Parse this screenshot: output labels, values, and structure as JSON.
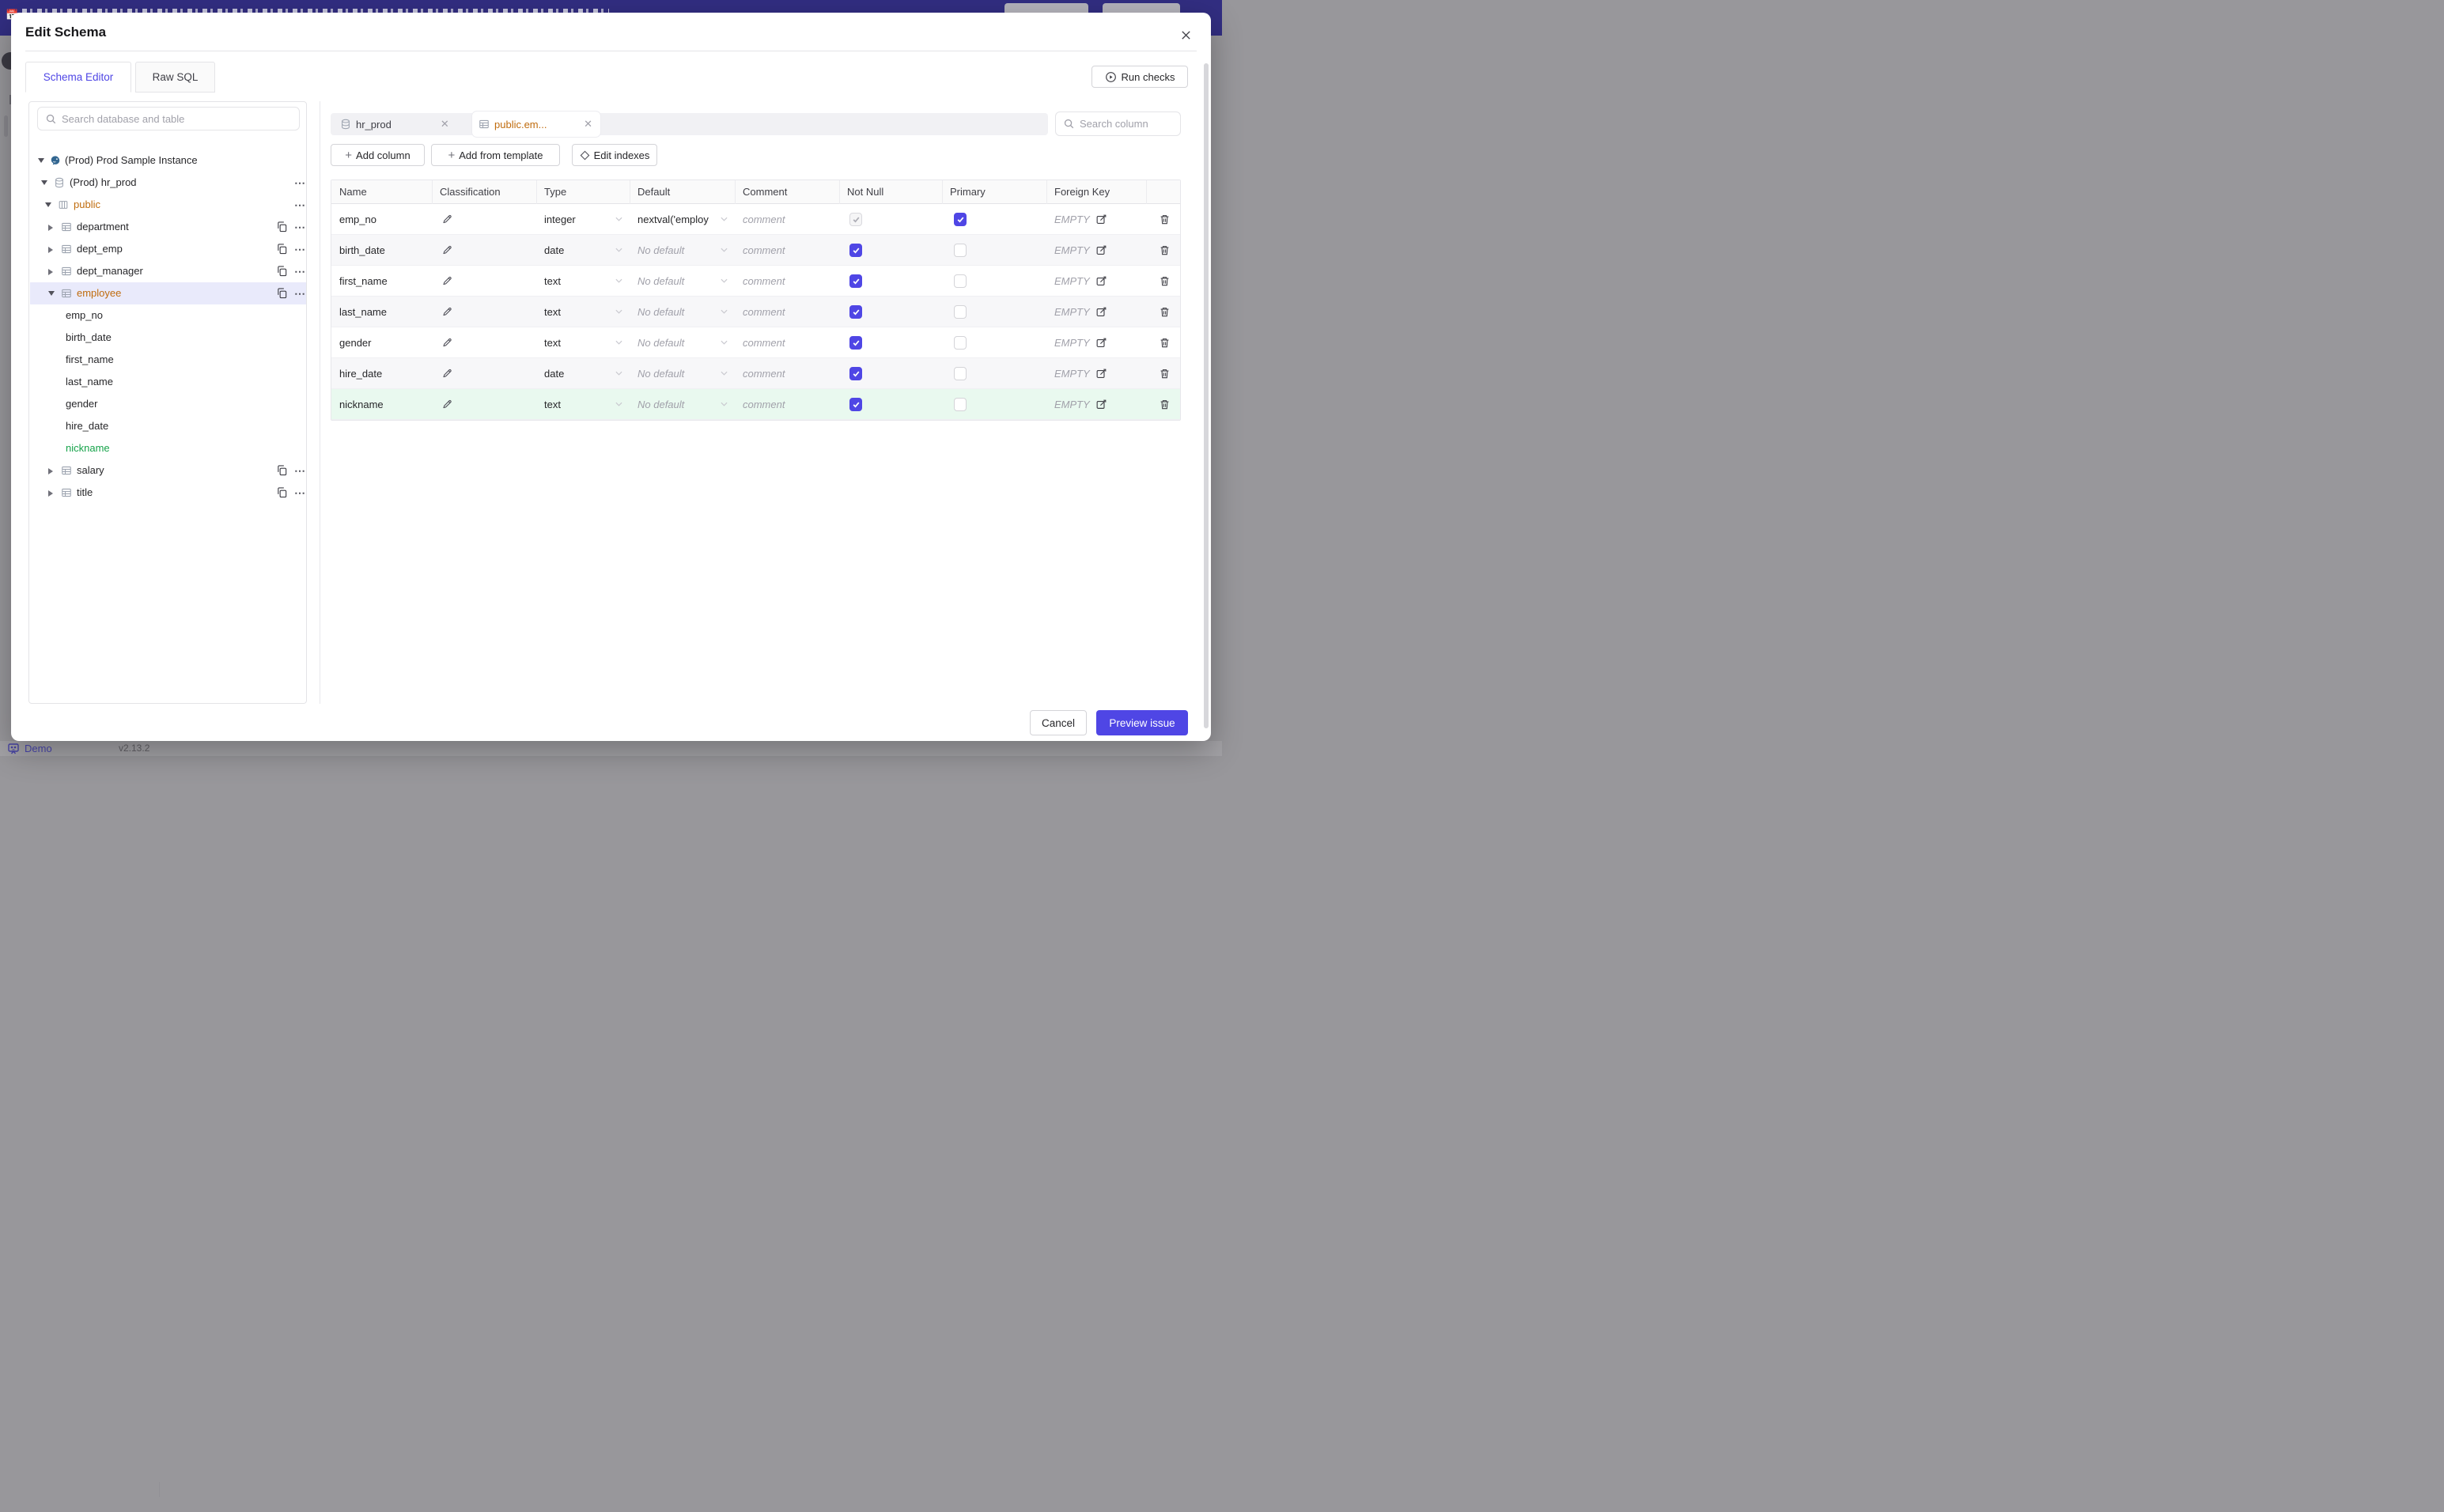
{
  "background": {
    "banner": {
      "calendar_icon": "📅"
    },
    "footer": {
      "demo_label": "Demo",
      "version": "v2.13.2"
    }
  },
  "dialog": {
    "title": "Edit Schema",
    "tabs": [
      {
        "label": "Schema Editor",
        "active": true
      },
      {
        "label": "Raw SQL",
        "active": false
      }
    ],
    "run_checks_label": "Run checks",
    "sidebar": {
      "search_placeholder": "Search database and table",
      "tree": [
        {
          "label": "(Prod) Prod Sample Instance",
          "icon": "postgres-instance",
          "level": 0,
          "state": "expanded"
        },
        {
          "label": "(Prod) hr_prod",
          "icon": "database",
          "level": 1,
          "state": "expanded",
          "has_menu": true
        },
        {
          "label": "public",
          "icon": "schema",
          "level": 2,
          "state": "expanded",
          "has_menu": true,
          "highlight": "orange"
        },
        {
          "label": "department",
          "icon": "table",
          "level": 3,
          "state": "collapsed",
          "has_copy": true,
          "has_menu": true
        },
        {
          "label": "dept_emp",
          "icon": "table",
          "level": 3,
          "state": "collapsed",
          "has_copy": true,
          "has_menu": true
        },
        {
          "label": "dept_manager",
          "icon": "table",
          "level": 3,
          "state": "collapsed",
          "has_copy": true,
          "has_menu": true
        },
        {
          "label": "employee",
          "icon": "table",
          "level": 3,
          "state": "expanded",
          "selected": true,
          "highlight": "orange",
          "has_copy": true,
          "has_menu": true
        },
        {
          "label": "emp_no",
          "kind": "column",
          "level": 4
        },
        {
          "label": "birth_date",
          "kind": "column",
          "level": 4
        },
        {
          "label": "first_name",
          "kind": "column",
          "level": 4
        },
        {
          "label": "last_name",
          "kind": "column",
          "level": 4
        },
        {
          "label": "gender",
          "kind": "column",
          "level": 4
        },
        {
          "label": "hire_date",
          "kind": "column",
          "level": 4
        },
        {
          "label": "nickname",
          "kind": "column",
          "level": 4,
          "highlight": "green"
        },
        {
          "label": "salary",
          "icon": "table",
          "level": 3,
          "state": "collapsed",
          "has_copy": true,
          "has_menu": true
        },
        {
          "label": "title",
          "icon": "table",
          "level": 3,
          "state": "collapsed",
          "has_copy": true,
          "has_menu": true
        }
      ]
    },
    "main": {
      "chips": [
        {
          "label": "hr_prod",
          "icon": "database",
          "active": false
        },
        {
          "label": "public.em...",
          "icon": "table",
          "active": true,
          "highlight": "orange"
        }
      ],
      "search_placeholder": "Search column",
      "toolbar": [
        {
          "label": "Add column",
          "icon": "plus"
        },
        {
          "label": "Add from template",
          "icon": "plus"
        },
        {
          "label": "Edit indexes",
          "icon": "diamond"
        }
      ],
      "table": {
        "headers": [
          "Name",
          "Classification",
          "Type",
          "Default",
          "Comment",
          "Not Null",
          "Primary",
          "Foreign Key"
        ],
        "comment_placeholder": "comment",
        "no_default_placeholder": "No default",
        "foreign_key_empty": "EMPTY",
        "rows": [
          {
            "name": "emp_no",
            "type": "integer",
            "default": "nextval('employ",
            "not_null": true,
            "not_null_disabled": true,
            "primary": true
          },
          {
            "name": "birth_date",
            "type": "date",
            "default": "",
            "not_null": true,
            "primary": false
          },
          {
            "name": "first_name",
            "type": "text",
            "default": "",
            "not_null": true,
            "primary": false
          },
          {
            "name": "last_name",
            "type": "text",
            "default": "",
            "not_null": true,
            "primary": false
          },
          {
            "name": "gender",
            "type": "text",
            "default": "",
            "not_null": true,
            "primary": false
          },
          {
            "name": "hire_date",
            "type": "date",
            "default": "",
            "not_null": true,
            "primary": false
          },
          {
            "name": "nickname",
            "type": "text",
            "default": "",
            "not_null": true,
            "primary": false,
            "row_highlight": "green"
          }
        ]
      }
    },
    "footer": {
      "cancel_label": "Cancel",
      "submit_label": "Preview issue"
    }
  },
  "colors": {
    "accent_indigo": "#4f46e5",
    "selected_orange": "#c06c0e",
    "added_green": "#16a34a",
    "added_row_bg": "#e9f9ef",
    "selected_row_bg": "#e9eafb",
    "banner_indigo": "#322e82"
  }
}
